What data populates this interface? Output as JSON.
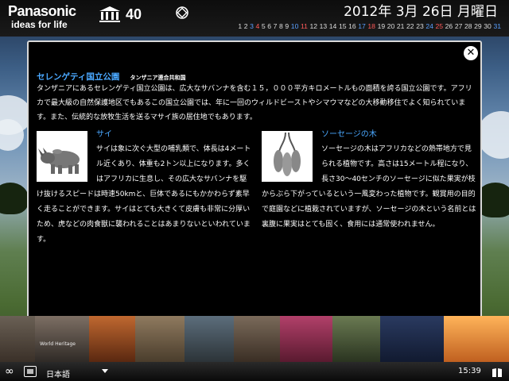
{
  "header": {
    "brand_name": "Panasonic",
    "brand_tagline": "ideas for life",
    "logo_40": "40",
    "date_text": "2012年 3月 26日 月曜日",
    "days": [
      {
        "n": "1",
        "k": "normal"
      },
      {
        "n": "2",
        "k": "normal"
      },
      {
        "n": "3",
        "k": "sat"
      },
      {
        "n": "4",
        "k": "sun"
      },
      {
        "n": "5",
        "k": "normal"
      },
      {
        "n": "6",
        "k": "normal"
      },
      {
        "n": "7",
        "k": "normal"
      },
      {
        "n": "8",
        "k": "normal"
      },
      {
        "n": "9",
        "k": "normal"
      },
      {
        "n": "10",
        "k": "sat"
      },
      {
        "n": "11",
        "k": "sun"
      },
      {
        "n": "12",
        "k": "normal"
      },
      {
        "n": "13",
        "k": "normal"
      },
      {
        "n": "14",
        "k": "normal"
      },
      {
        "n": "15",
        "k": "normal"
      },
      {
        "n": "16",
        "k": "normal"
      },
      {
        "n": "17",
        "k": "sat"
      },
      {
        "n": "18",
        "k": "sun"
      },
      {
        "n": "19",
        "k": "normal"
      },
      {
        "n": "20",
        "k": "normal"
      },
      {
        "n": "21",
        "k": "normal"
      },
      {
        "n": "22",
        "k": "normal"
      },
      {
        "n": "23",
        "k": "normal"
      },
      {
        "n": "24",
        "k": "sat"
      },
      {
        "n": "25",
        "k": "sun"
      },
      {
        "n": "26",
        "k": "normal"
      },
      {
        "n": "27",
        "k": "normal"
      },
      {
        "n": "28",
        "k": "normal"
      },
      {
        "n": "29",
        "k": "normal"
      },
      {
        "n": "30",
        "k": "normal"
      },
      {
        "n": "31",
        "k": "sat"
      }
    ]
  },
  "modal": {
    "close_icon": "close-icon",
    "title": "セレンゲティ国立公園",
    "subtitle": "タンザニア連合共和国",
    "intro": "タンザニアにあるセレンゲティ国立公園は、広大なサバンナを含む１５，０００平方キロメートルもの面積を誇る国立公園です。アフリカで最大級の自然保護地区でもあるこの国立公園では、年に一回のウィルドビーストやシマウマなどの大移動移住でよく知られています。また、伝統的な放牧生活を送るマサイ族の居住地でもあります。",
    "sections": [
      {
        "heading": "サイ",
        "icon": "rhino-icon",
        "body": "サイは象に次ぐ大型の哺乳類で、体長は4メートル近くあり、体重も2トン以上になります。多くはアフリカに生息し、その広大なサバンナを駆け抜けるスピードは時速50kmと、巨体であるにもかかわらず素早く走ることができます。サイはとても大きくて皮膚も非常に分厚いため、虎などの肉食獣に襲われることはあまりないといわれています。"
      },
      {
        "heading": "ソーセージの木",
        "icon": "sausage-tree-icon",
        "body": "ソーセージの木はアフリカなどの熱帯地方で見られる植物です。高さは15メートル程になり、長さ30〜40センチのソーセージに似た果実が枝からぶら下がっているという一風変わった植物です。観賞用の目的で庭園などに植栽されていますが、ソーセージの木という名前とは裏腹に果実はとても固く、食用には通常使われません。"
      }
    ]
  },
  "strip": {
    "tile_label": "World Heritage"
  },
  "toolbar": {
    "language": "日本語",
    "time": "15:39"
  },
  "colors": {
    "accent": "#4aa8ff",
    "saturday": "#5aa0ff",
    "sunday": "#ff5a5a"
  }
}
